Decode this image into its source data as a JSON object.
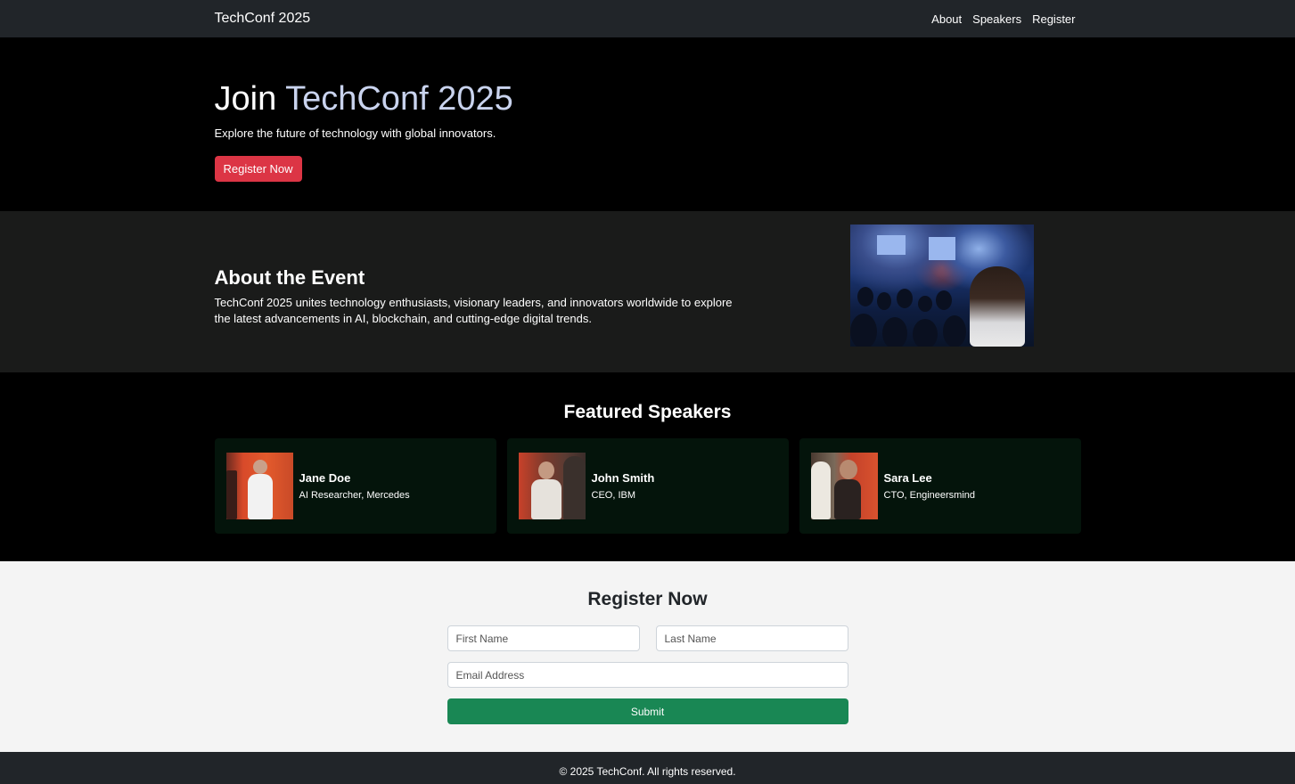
{
  "nav": {
    "brand": "TechConf 2025",
    "links": [
      "About",
      "Speakers",
      "Register"
    ]
  },
  "hero": {
    "title_prefix": "Join ",
    "title_accent": "TechConf 2025",
    "subtitle": "Explore the future of technology with global innovators.",
    "cta": "Register Now"
  },
  "about": {
    "title": "About the Event",
    "body": "TechConf 2025 unites technology enthusiasts, visionary leaders, and innovators worldwide to explore the latest advancements in AI, blockchain, and cutting-edge digital trends."
  },
  "speakers": {
    "title": "Featured Speakers",
    "items": [
      {
        "name": "Jane Doe",
        "role": "AI Researcher, Mercedes"
      },
      {
        "name": "John Smith",
        "role": "CEO, IBM"
      },
      {
        "name": "Sara Lee",
        "role": "CTO, Engineersmind"
      }
    ]
  },
  "register": {
    "title": "Register Now",
    "first_name_placeholder": "First Name",
    "last_name_placeholder": "Last Name",
    "email_placeholder": "Email Address",
    "submit": "Submit"
  },
  "footer": {
    "text": "© 2025 TechConf. All rights reserved."
  },
  "colors": {
    "navbar": "#212529",
    "cta_red": "#dc3545",
    "submit_green": "#198754",
    "speaker_card": "#04140b",
    "about_bg": "#1a1b1a"
  }
}
